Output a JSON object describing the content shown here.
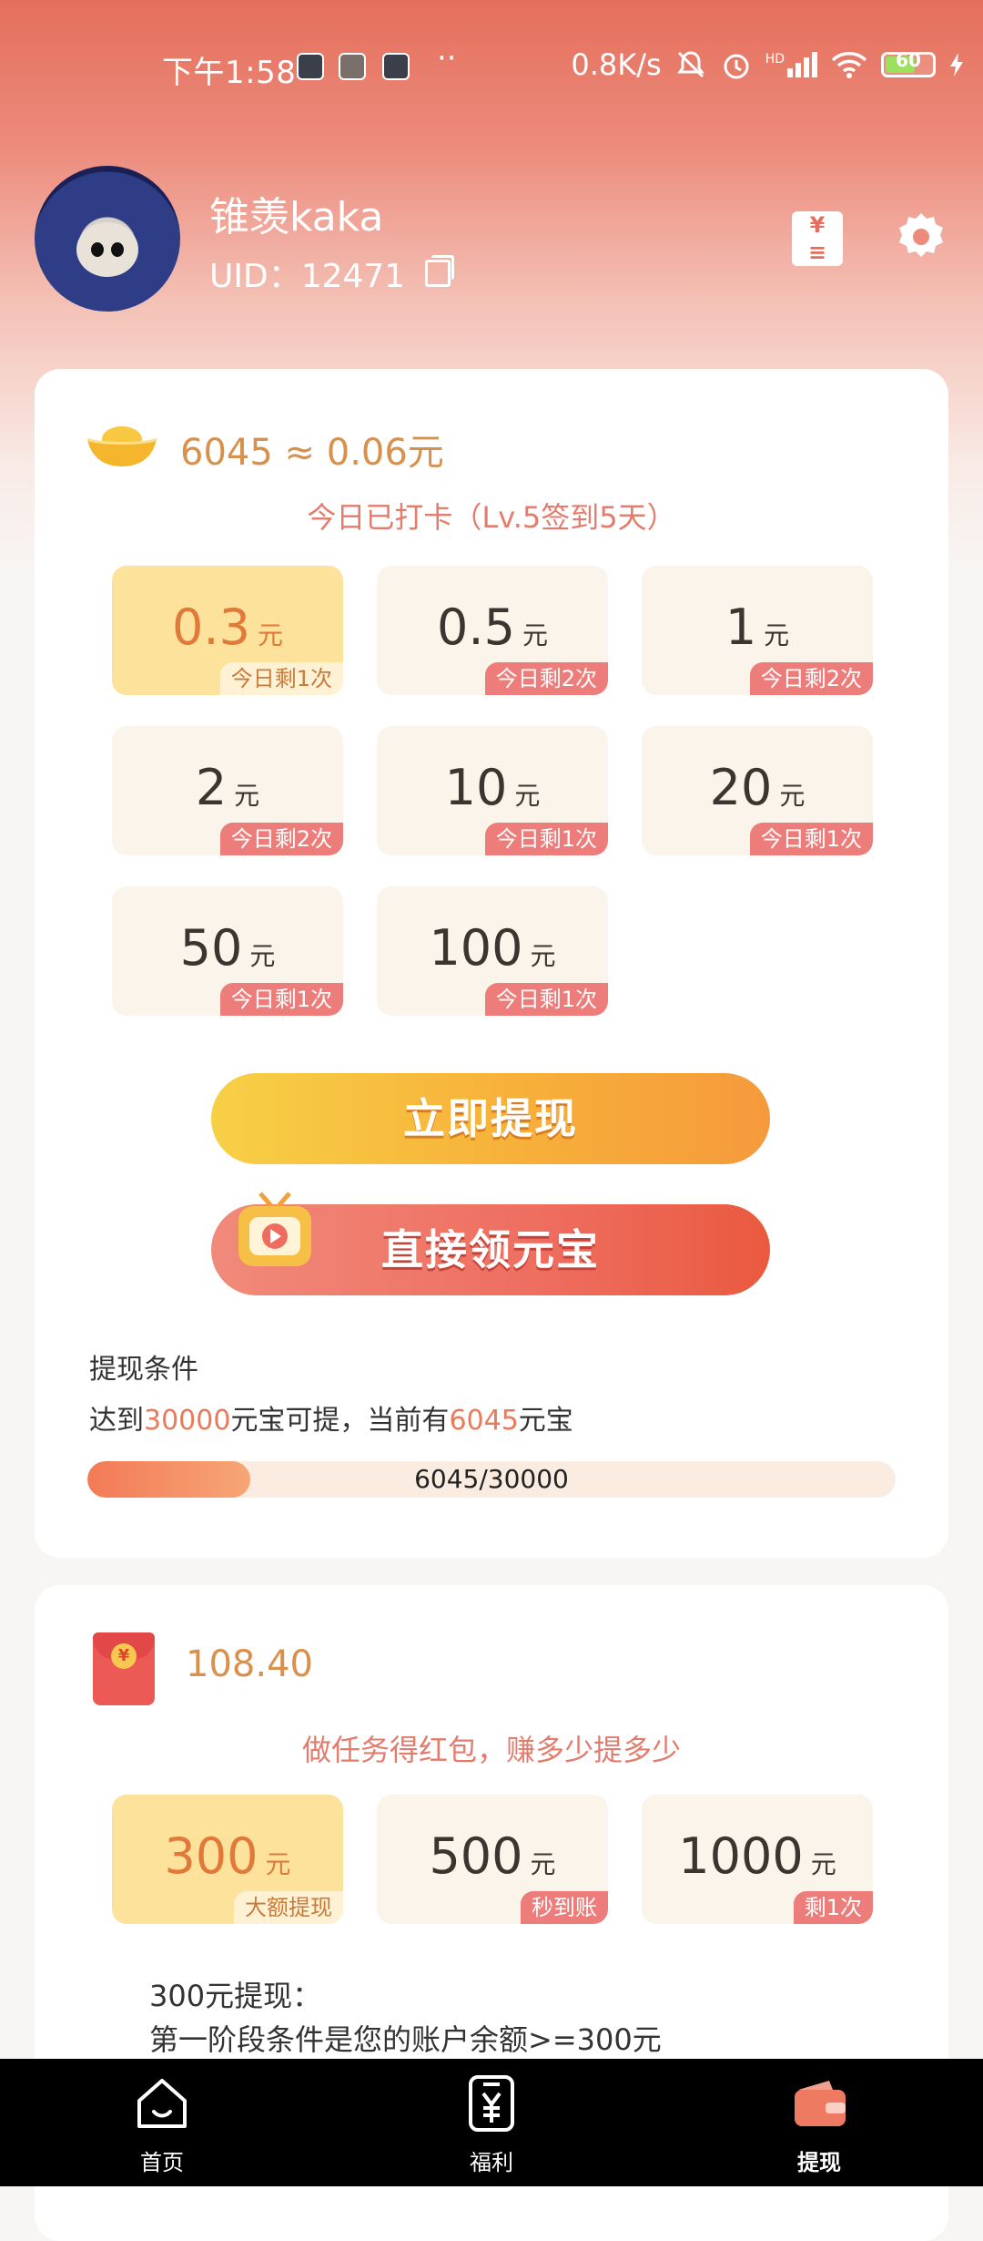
{
  "status_bar": {
    "time": "下午1:58",
    "dots": "··",
    "net_speed": "0.8K/s",
    "signal": "HD",
    "battery": "60"
  },
  "profile": {
    "username": "锥羡kaka",
    "uid_label": "UID：12471"
  },
  "coins": {
    "line": "6045 ≈ 0.06元",
    "checkin": "今日已打卡（Lv.5签到5天）"
  },
  "withdraw_options": [
    {
      "amount": "0.3",
      "unit": "元",
      "tag": "今日剩1次",
      "selected": true
    },
    {
      "amount": "0.5",
      "unit": "元",
      "tag": "今日剩2次",
      "selected": false
    },
    {
      "amount": "1",
      "unit": "元",
      "tag": "今日剩2次",
      "selected": false
    },
    {
      "amount": "2",
      "unit": "元",
      "tag": "今日剩2次",
      "selected": false
    },
    {
      "amount": "10",
      "unit": "元",
      "tag": "今日剩1次",
      "selected": false
    },
    {
      "amount": "20",
      "unit": "元",
      "tag": "今日剩1次",
      "selected": false
    },
    {
      "amount": "50",
      "unit": "元",
      "tag": "今日剩1次",
      "selected": false
    },
    {
      "amount": "100",
      "unit": "元",
      "tag": "今日剩1次",
      "selected": false
    }
  ],
  "buttons": {
    "withdraw": "立即提现",
    "get_ingots": "直接领元宝"
  },
  "condition": {
    "title": "提现条件",
    "text_pre": "达到",
    "target": "30000",
    "text_mid": "元宝可提，当前有",
    "current": "6045",
    "text_post": "元宝",
    "progress_label": "6045/30000",
    "progress_fraction": 0.2015
  },
  "red_packet": {
    "amount": "108.40",
    "subtitle": "做任务得红包，赚多少提多少",
    "options": [
      {
        "amount": "300",
        "unit": "元",
        "tag": "大额提现",
        "selected": true
      },
      {
        "amount": "500",
        "unit": "元",
        "tag": "秒到账",
        "selected": false
      },
      {
        "amount": "1000",
        "unit": "元",
        "tag": "剩1次",
        "selected": false
      }
    ],
    "desc_title": "300元提现：",
    "desc_line": "第一阶段条件是您的账户余额>=300元"
  },
  "nav": {
    "home": "首页",
    "welfare": "福利",
    "withdraw": "提现"
  },
  "colors": {
    "accent": "#e56f5c",
    "tag": "#ed7d7a",
    "gold": "#d8914c"
  }
}
